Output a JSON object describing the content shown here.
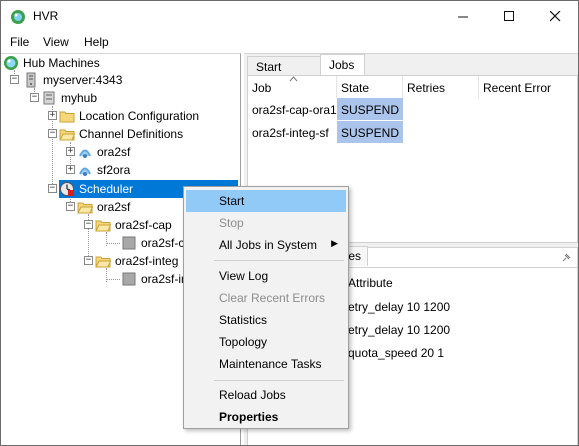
{
  "window": {
    "title": "HVR"
  },
  "menubar": {
    "file": "File",
    "view": "View",
    "help": "Help"
  },
  "tree": {
    "root": "Hub Machines",
    "server": "myserver:4343",
    "hub": "myhub",
    "location_config": "Location Configuration",
    "channel_defs": "Channel Definitions",
    "channel_1": "ora2sf",
    "channel_2": "sf2ora",
    "scheduler": "Scheduler",
    "sched_group": "ora2sf",
    "cap_folder": "ora2sf-cap",
    "cap_job": "ora2sf-ca",
    "integ_folder": "ora2sf-integ",
    "integ_job": "ora2sf-in"
  },
  "tabs": {
    "start_page": "Start Page",
    "jobs": "Jobs"
  },
  "jobs_table": {
    "columns": [
      "Job",
      "State",
      "Retries",
      "Recent Error"
    ],
    "rows": [
      {
        "job": "ora2sf-cap-ora1",
        "state": "SUSPEND"
      },
      {
        "job": "ora2sf-integ-sf",
        "state": "SUSPEND"
      }
    ]
  },
  "attr_panel": {
    "tab_fragment": "tes",
    "header": "Attribute",
    "rows": [
      "etry_delay 10 1200",
      "etry_delay 10 1200",
      "quota_speed 20 1"
    ]
  },
  "context_menu": {
    "start": "Start",
    "stop": "Stop",
    "all_jobs": "All Jobs in System",
    "view_log": "View Log",
    "clear_errors": "Clear Recent Errors",
    "statistics": "Statistics",
    "topology": "Topology",
    "maintenance": "Maintenance Tasks",
    "reload_jobs": "Reload Jobs",
    "properties": "Properties"
  },
  "colors": {
    "selection": "#0078d7",
    "suspend_bg": "#aac4ec",
    "menu_highlight": "#91c9f7"
  }
}
